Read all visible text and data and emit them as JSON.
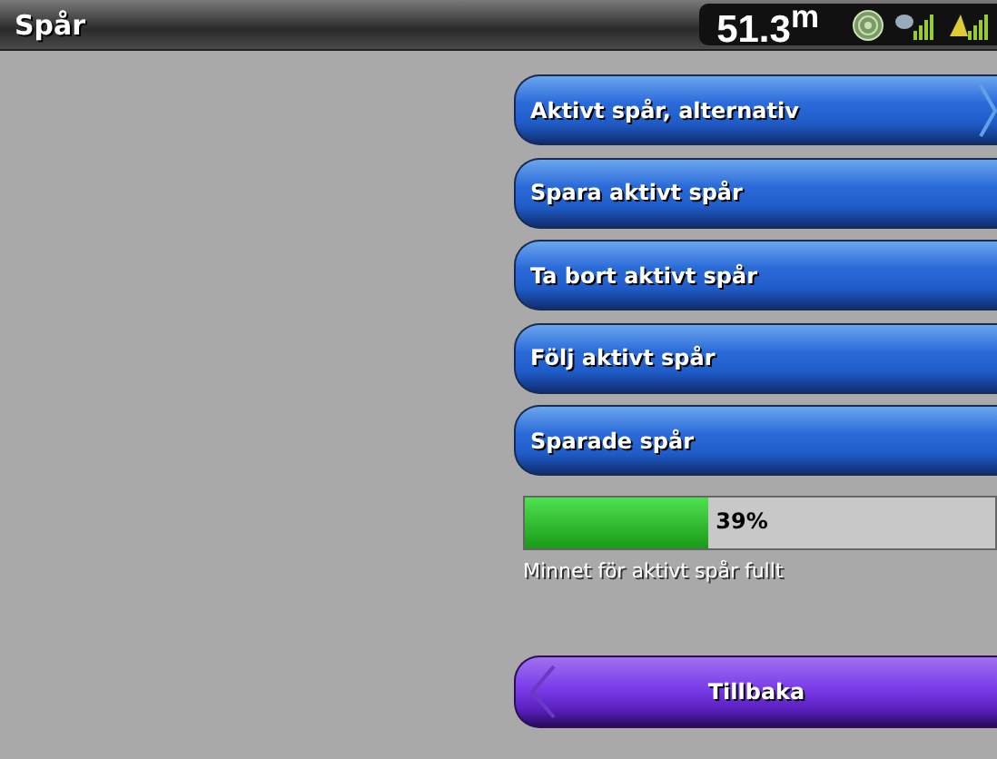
{
  "title_bar": {
    "title": "Spår",
    "reading": "51.3$^{m}$"
  },
  "menu": [
    {
      "label": "Aktivt spår, alternativ",
      "kind": "submenu"
    },
    {
      "label": "Spara aktivt spår",
      "kind": "plain"
    },
    {
      "label": "Ta bort aktivt spår",
      "kind": "plain"
    },
    {
      "label": "Följ aktivt spår",
      "kind": "plain"
    },
    {
      "label": "Sparade spår",
      "kind": "plain"
    }
  ],
  "memory": {
    "level": 0.39,
    "reading": "39%",
    "caption": "Minnet för aktivt spår fullt"
  },
  "back_button": {
    "label": "Tillbaka"
  }
}
